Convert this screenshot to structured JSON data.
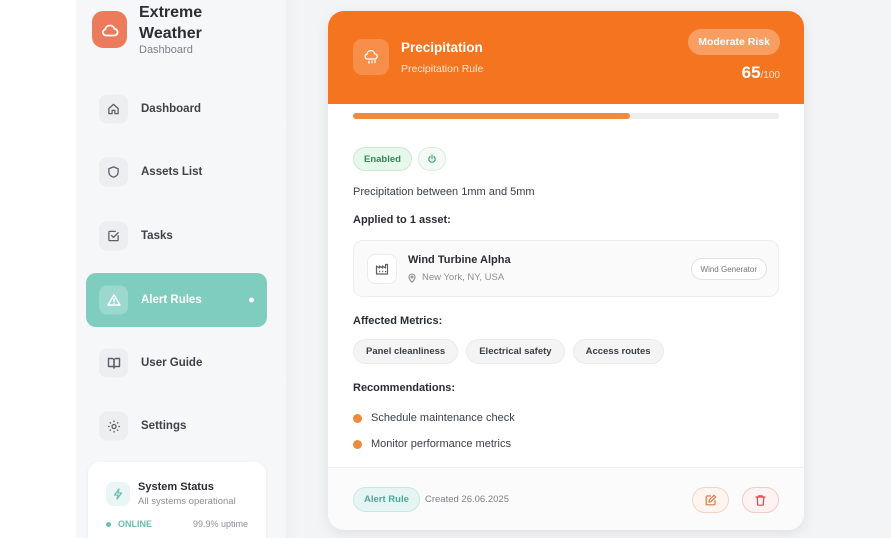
{
  "brand": {
    "title": "Extreme Weather",
    "subtitle": "Dashboard",
    "icon": "cloud-icon"
  },
  "sidebar": {
    "items": [
      {
        "label": "Dashboard",
        "icon": "home-icon"
      },
      {
        "label": "Assets List",
        "icon": "shield-icon"
      },
      {
        "label": "Tasks",
        "icon": "checkbox-icon"
      },
      {
        "label": "Alert Rules",
        "icon": "warning-icon",
        "active": true
      },
      {
        "label": "User Guide",
        "icon": "book-icon"
      },
      {
        "label": "Settings",
        "icon": "gear-icon"
      }
    ]
  },
  "system_status": {
    "title": "System Status",
    "subtitle": "All systems operational",
    "state": "ONLINE",
    "uptime": "99.9% uptime"
  },
  "rule": {
    "title": "Precipitation",
    "subtitle": "Precipitation Rule",
    "risk_label": "Moderate Risk",
    "score": "65",
    "score_max": "/100",
    "score_fraction": 0.65,
    "status": "Enabled",
    "description": "Precipitation between 1mm and 5mm",
    "applied_title": "Applied to 1 asset:",
    "asset": {
      "name": "Wind Turbine Alpha",
      "location": "New York, NY, USA",
      "type": "Wind Generator"
    },
    "metrics_title": "Affected Metrics:",
    "metrics": [
      "Panel cleanliness",
      "Electrical safety",
      "Access routes"
    ],
    "recommendations_title": "Recommendations:",
    "recommendations": [
      "Schedule maintenance check",
      "Monitor performance metrics"
    ],
    "footer_badge": "Alert Rule",
    "created": "Created 26.06.2025"
  },
  "colors": {
    "header": "#f5741f",
    "accent": "#7fcdbf",
    "logo": "#ee7a5c"
  }
}
